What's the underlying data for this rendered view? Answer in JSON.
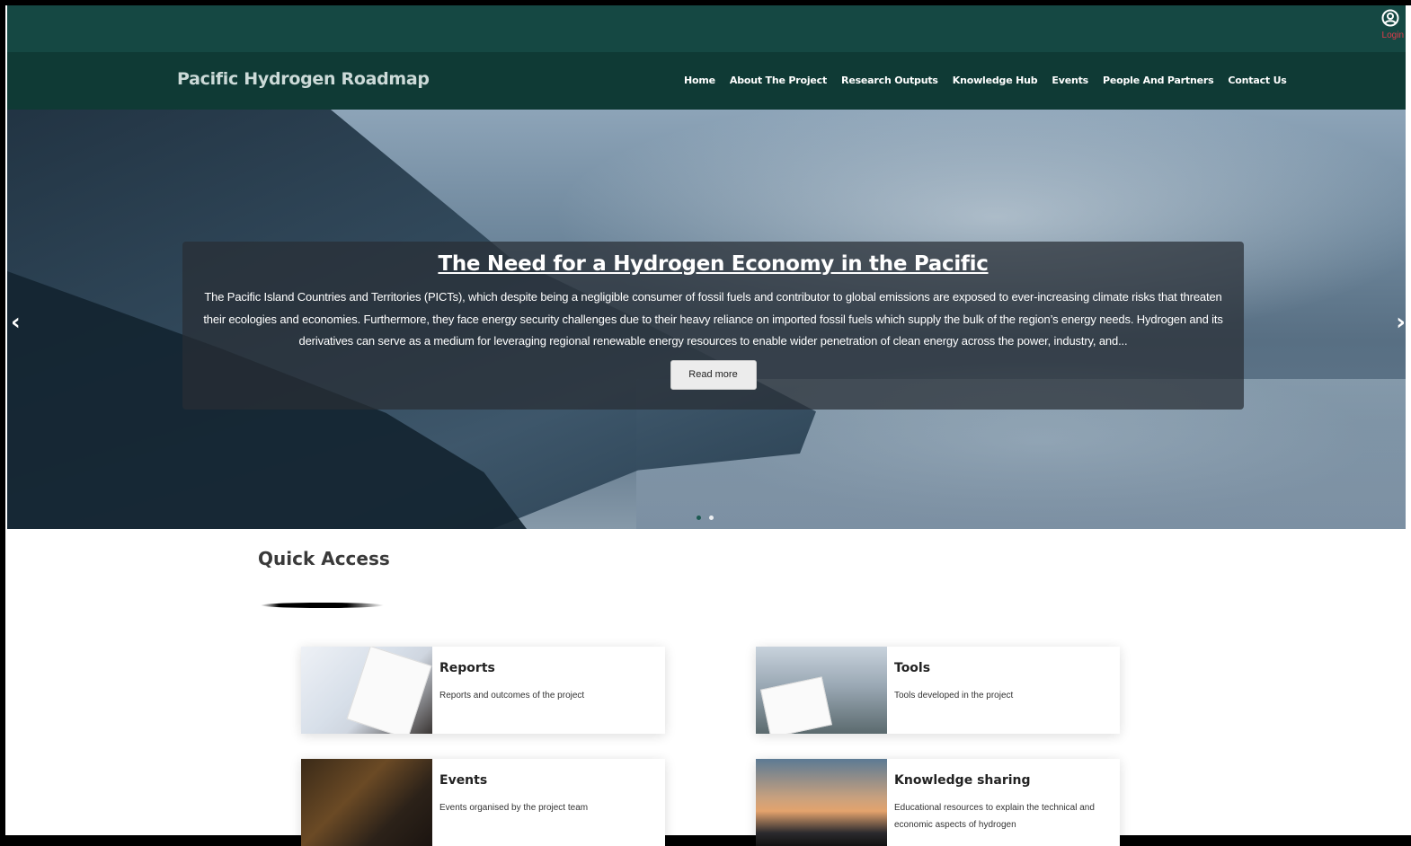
{
  "login": {
    "icon": "user-circle-icon",
    "label": "Login"
  },
  "brand": "Pacific Hydrogen Roadmap",
  "nav": [
    "Home",
    "About The Project",
    "Research Outputs",
    "Knowledge Hub",
    "Events",
    "People And Partners",
    "Contact Us"
  ],
  "hero": {
    "title": "The Need for a Hydrogen Economy in the Pacific",
    "body": "The Pacific Island Countries and Territories (PICTs), which despite being a negligible consumer of fossil fuels and contributor to global emissions are exposed to ever-increasing climate risks that threaten their ecologies and economies. Furthermore, they face energy security challenges due to their heavy reliance on imported fossil fuels which supply the bulk of the region’s energy needs. Hydrogen and its derivatives can serve as a medium for leveraging regional renewable energy resources to enable wider penetration of clean energy across the power, industry, and...",
    "button": "Read more",
    "prev_icon": "chevron-left-icon",
    "next_icon": "chevron-right-icon",
    "slides": 2,
    "active_slide": 1
  },
  "quick_access": {
    "title": "Quick Access",
    "cards": [
      {
        "title": "Reports",
        "desc": "Reports and outcomes of the project"
      },
      {
        "title": "Tools",
        "desc": "Tools developed in the project"
      },
      {
        "title": "Events",
        "desc": "Events organised by the project team"
      },
      {
        "title": "Knowledge sharing",
        "desc": "Educational resources to explain the technical and economic aspects of hydrogen"
      }
    ]
  },
  "colors": {
    "topbar": "#154843",
    "navbar": "#0f3a35",
    "login": "#e23b4b"
  }
}
